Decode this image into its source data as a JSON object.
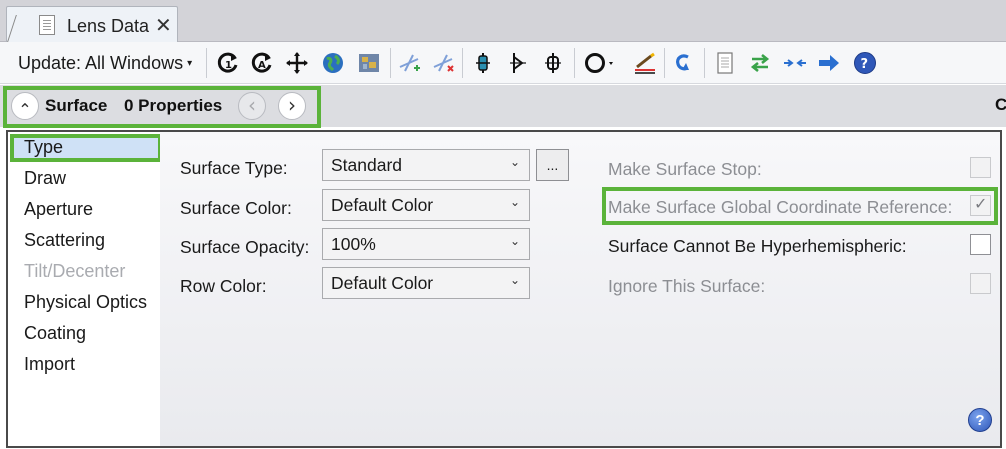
{
  "tab": {
    "title": "Lens Data",
    "close_glyph": "✕"
  },
  "toolbar": {
    "update_label": "Update: All Windows",
    "update_caret": "▾",
    "icons": [
      "refresh-1-icon",
      "refresh-all-icon",
      "move-crosshair-icon",
      "globe-icon",
      "map-icon",
      "add-coordinate-icon",
      "remove-coordinate-icon",
      "tilt-decenter-icon",
      "reverse-elements-icon",
      "make-focal-icon",
      "circle-dropdown-icon",
      "solve-wand-icon",
      "undo-arrow-icon",
      "document-icon",
      "swap-arrows-icon",
      "collapse-arrows-icon",
      "right-arrow-icon",
      "help-icon"
    ]
  },
  "surface_header": {
    "collapse_glyph": "⌃",
    "title": "Surface",
    "properties": "0 Properties",
    "prev_glyph": "‹",
    "next_glyph": "›",
    "cut_letter": "C"
  },
  "sidebar": {
    "items": [
      {
        "label": "Type",
        "selected": true,
        "enabled": true
      },
      {
        "label": "Draw",
        "enabled": true
      },
      {
        "label": "Aperture",
        "enabled": true
      },
      {
        "label": "Scattering",
        "enabled": true
      },
      {
        "label": "Tilt/Decenter",
        "enabled": false
      },
      {
        "label": "Physical Optics",
        "enabled": true
      },
      {
        "label": "Coating",
        "enabled": true
      },
      {
        "label": "Import",
        "enabled": true
      }
    ]
  },
  "form": {
    "surface_type": {
      "label": "Surface Type:",
      "value": "Standard",
      "ellipsis": "..."
    },
    "surface_color": {
      "label": "Surface Color:",
      "value": "Default Color"
    },
    "surface_opacity": {
      "label": "Surface Opacity:",
      "value": "100%"
    },
    "row_color": {
      "label": "Row Color:",
      "value": "Default Color"
    },
    "dropdown_glyph": "⌄",
    "make_surface_stop": {
      "label": "Make Surface Stop:",
      "checked": false,
      "enabled": false
    },
    "global_coord_ref": {
      "label": "Make Surface Global Coordinate Reference:",
      "checked": true,
      "enabled": false,
      "check_glyph": "✓"
    },
    "cannot_be_hyperhemispheric": {
      "label": "Surface Cannot Be Hyperhemispheric:",
      "checked": false,
      "enabled": true
    },
    "ignore_surface": {
      "label": "Ignore This Surface:",
      "checked": false,
      "enabled": false
    }
  },
  "help": {
    "glyph": "?"
  },
  "colors": {
    "highlight_green": "#5bb33a",
    "selection_blue": "#cfe1f6"
  }
}
